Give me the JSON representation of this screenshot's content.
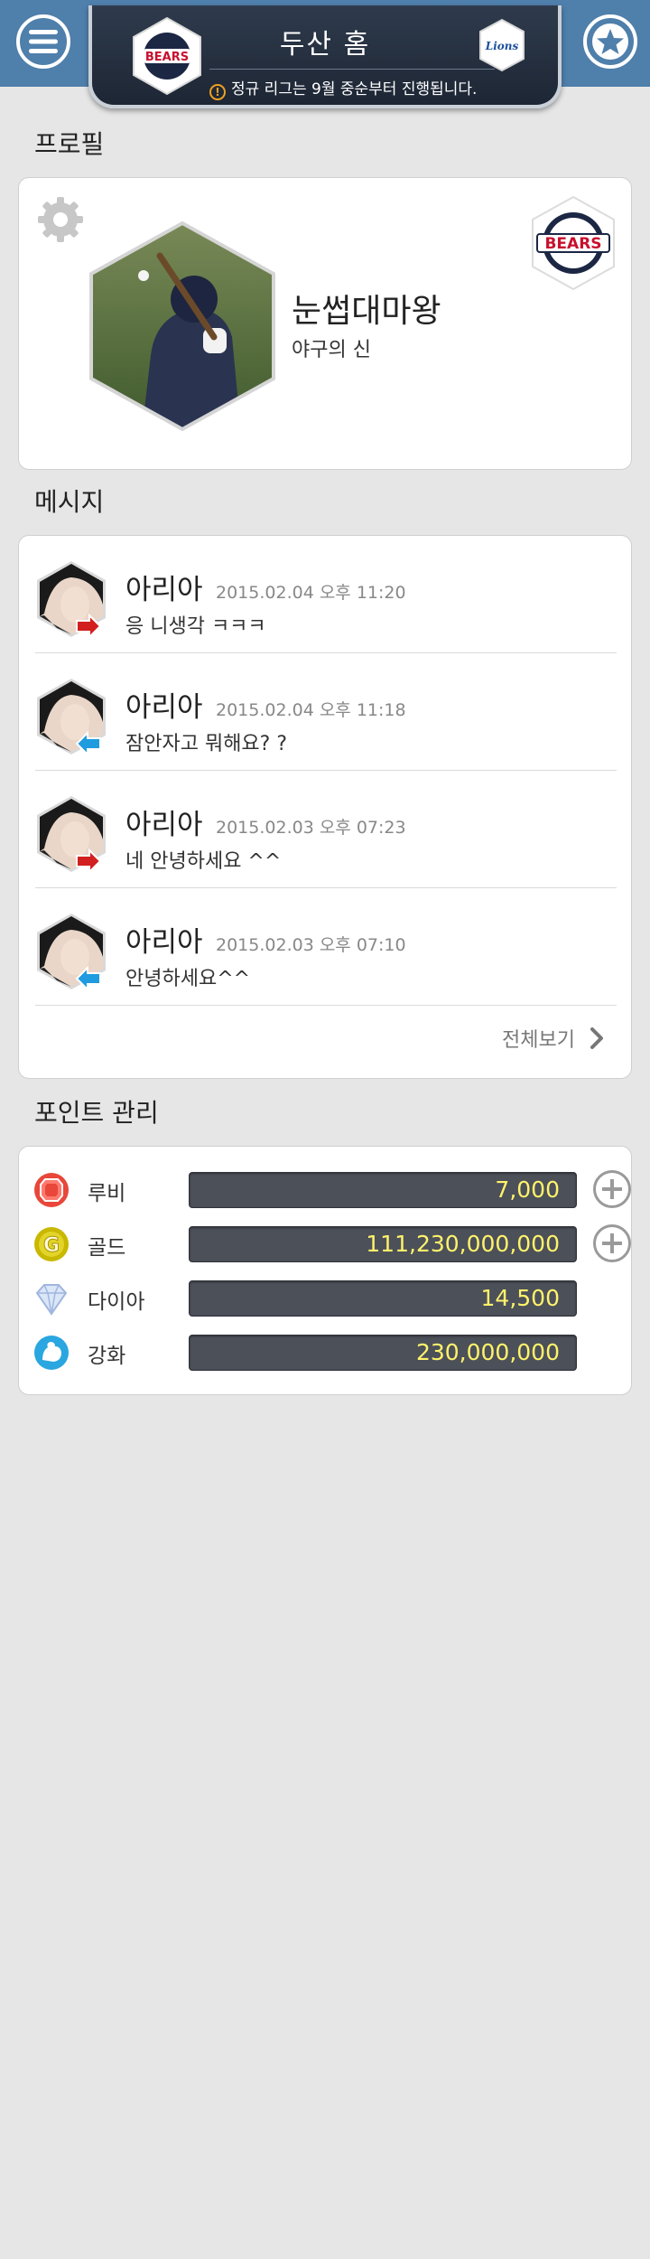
{
  "header": {
    "title": "두산 홈",
    "notice": "정규 리그는 9월 중순부터 진행됩니다.",
    "home_team_logo_text": "BEARS",
    "away_team_logo_text": "Lions",
    "menu_icon": "menu-icon",
    "favorite_icon": "star-icon"
  },
  "profile": {
    "section_title": "프로필",
    "nickname": "눈썹대마왕",
    "subtitle": "야구의 신",
    "team_logo_text": "BEARS"
  },
  "messages": {
    "section_title": "메시지",
    "items": [
      {
        "name": "아리아",
        "date": "2015.02.04 오후 11:20",
        "text": "응 니생각 ㅋㅋㅋ",
        "direction": "sent"
      },
      {
        "name": "아리아",
        "date": "2015.02.04 오후 11:18",
        "text": "잠안자고 뭐해요? ?",
        "direction": "received"
      },
      {
        "name": "아리아",
        "date": "2015.02.03 오후 07:23",
        "text": "네 안녕하세요 ^^",
        "direction": "sent"
      },
      {
        "name": "아리아",
        "date": "2015.02.03 오후 07:10",
        "text": "안녕하세요^^",
        "direction": "received"
      }
    ],
    "view_all_label": "전체보기"
  },
  "points": {
    "section_title": "포인트 관리",
    "items": [
      {
        "label": "루비",
        "value": "7,000",
        "icon": "ruby-icon",
        "color": "#e8473a"
      },
      {
        "label": "골드",
        "value": "111,230,000,000",
        "icon": "gold-icon",
        "color": "#c9b800"
      },
      {
        "label": "다이아",
        "value": "14,500",
        "icon": "diamond-icon",
        "color": "#9fb6df"
      },
      {
        "label": "강화",
        "value": "230,000,000",
        "icon": "power-icon",
        "color": "#2aa6e0"
      }
    ]
  },
  "colors": {
    "topbar": "#4f7fab",
    "sent_arrow": "#d21f1f",
    "received_arrow": "#1f9be0",
    "point_value": "#fff36a"
  }
}
